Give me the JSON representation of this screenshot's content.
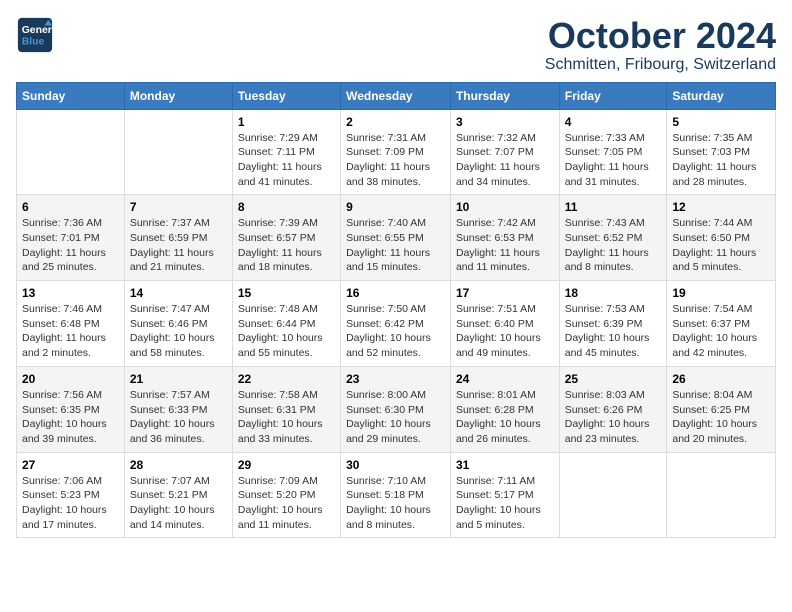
{
  "header": {
    "logo": {
      "general": "General",
      "blue": "Blue"
    },
    "month": "October 2024",
    "location": "Schmitten, Fribourg, Switzerland"
  },
  "columns": [
    "Sunday",
    "Monday",
    "Tuesday",
    "Wednesday",
    "Thursday",
    "Friday",
    "Saturday"
  ],
  "weeks": [
    [
      {
        "day": "",
        "sunrise": "",
        "sunset": "",
        "daylight": ""
      },
      {
        "day": "",
        "sunrise": "",
        "sunset": "",
        "daylight": ""
      },
      {
        "day": "1",
        "sunrise": "Sunrise: 7:29 AM",
        "sunset": "Sunset: 7:11 PM",
        "daylight": "Daylight: 11 hours and 41 minutes."
      },
      {
        "day": "2",
        "sunrise": "Sunrise: 7:31 AM",
        "sunset": "Sunset: 7:09 PM",
        "daylight": "Daylight: 11 hours and 38 minutes."
      },
      {
        "day": "3",
        "sunrise": "Sunrise: 7:32 AM",
        "sunset": "Sunset: 7:07 PM",
        "daylight": "Daylight: 11 hours and 34 minutes."
      },
      {
        "day": "4",
        "sunrise": "Sunrise: 7:33 AM",
        "sunset": "Sunset: 7:05 PM",
        "daylight": "Daylight: 11 hours and 31 minutes."
      },
      {
        "day": "5",
        "sunrise": "Sunrise: 7:35 AM",
        "sunset": "Sunset: 7:03 PM",
        "daylight": "Daylight: 11 hours and 28 minutes."
      }
    ],
    [
      {
        "day": "6",
        "sunrise": "Sunrise: 7:36 AM",
        "sunset": "Sunset: 7:01 PM",
        "daylight": "Daylight: 11 hours and 25 minutes."
      },
      {
        "day": "7",
        "sunrise": "Sunrise: 7:37 AM",
        "sunset": "Sunset: 6:59 PM",
        "daylight": "Daylight: 11 hours and 21 minutes."
      },
      {
        "day": "8",
        "sunrise": "Sunrise: 7:39 AM",
        "sunset": "Sunset: 6:57 PM",
        "daylight": "Daylight: 11 hours and 18 minutes."
      },
      {
        "day": "9",
        "sunrise": "Sunrise: 7:40 AM",
        "sunset": "Sunset: 6:55 PM",
        "daylight": "Daylight: 11 hours and 15 minutes."
      },
      {
        "day": "10",
        "sunrise": "Sunrise: 7:42 AM",
        "sunset": "Sunset: 6:53 PM",
        "daylight": "Daylight: 11 hours and 11 minutes."
      },
      {
        "day": "11",
        "sunrise": "Sunrise: 7:43 AM",
        "sunset": "Sunset: 6:52 PM",
        "daylight": "Daylight: 11 hours and 8 minutes."
      },
      {
        "day": "12",
        "sunrise": "Sunrise: 7:44 AM",
        "sunset": "Sunset: 6:50 PM",
        "daylight": "Daylight: 11 hours and 5 minutes."
      }
    ],
    [
      {
        "day": "13",
        "sunrise": "Sunrise: 7:46 AM",
        "sunset": "Sunset: 6:48 PM",
        "daylight": "Daylight: 11 hours and 2 minutes."
      },
      {
        "day": "14",
        "sunrise": "Sunrise: 7:47 AM",
        "sunset": "Sunset: 6:46 PM",
        "daylight": "Daylight: 10 hours and 58 minutes."
      },
      {
        "day": "15",
        "sunrise": "Sunrise: 7:48 AM",
        "sunset": "Sunset: 6:44 PM",
        "daylight": "Daylight: 10 hours and 55 minutes."
      },
      {
        "day": "16",
        "sunrise": "Sunrise: 7:50 AM",
        "sunset": "Sunset: 6:42 PM",
        "daylight": "Daylight: 10 hours and 52 minutes."
      },
      {
        "day": "17",
        "sunrise": "Sunrise: 7:51 AM",
        "sunset": "Sunset: 6:40 PM",
        "daylight": "Daylight: 10 hours and 49 minutes."
      },
      {
        "day": "18",
        "sunrise": "Sunrise: 7:53 AM",
        "sunset": "Sunset: 6:39 PM",
        "daylight": "Daylight: 10 hours and 45 minutes."
      },
      {
        "day": "19",
        "sunrise": "Sunrise: 7:54 AM",
        "sunset": "Sunset: 6:37 PM",
        "daylight": "Daylight: 10 hours and 42 minutes."
      }
    ],
    [
      {
        "day": "20",
        "sunrise": "Sunrise: 7:56 AM",
        "sunset": "Sunset: 6:35 PM",
        "daylight": "Daylight: 10 hours and 39 minutes."
      },
      {
        "day": "21",
        "sunrise": "Sunrise: 7:57 AM",
        "sunset": "Sunset: 6:33 PM",
        "daylight": "Daylight: 10 hours and 36 minutes."
      },
      {
        "day": "22",
        "sunrise": "Sunrise: 7:58 AM",
        "sunset": "Sunset: 6:31 PM",
        "daylight": "Daylight: 10 hours and 33 minutes."
      },
      {
        "day": "23",
        "sunrise": "Sunrise: 8:00 AM",
        "sunset": "Sunset: 6:30 PM",
        "daylight": "Daylight: 10 hours and 29 minutes."
      },
      {
        "day": "24",
        "sunrise": "Sunrise: 8:01 AM",
        "sunset": "Sunset: 6:28 PM",
        "daylight": "Daylight: 10 hours and 26 minutes."
      },
      {
        "day": "25",
        "sunrise": "Sunrise: 8:03 AM",
        "sunset": "Sunset: 6:26 PM",
        "daylight": "Daylight: 10 hours and 23 minutes."
      },
      {
        "day": "26",
        "sunrise": "Sunrise: 8:04 AM",
        "sunset": "Sunset: 6:25 PM",
        "daylight": "Daylight: 10 hours and 20 minutes."
      }
    ],
    [
      {
        "day": "27",
        "sunrise": "Sunrise: 7:06 AM",
        "sunset": "Sunset: 5:23 PM",
        "daylight": "Daylight: 10 hours and 17 minutes."
      },
      {
        "day": "28",
        "sunrise": "Sunrise: 7:07 AM",
        "sunset": "Sunset: 5:21 PM",
        "daylight": "Daylight: 10 hours and 14 minutes."
      },
      {
        "day": "29",
        "sunrise": "Sunrise: 7:09 AM",
        "sunset": "Sunset: 5:20 PM",
        "daylight": "Daylight: 10 hours and 11 minutes."
      },
      {
        "day": "30",
        "sunrise": "Sunrise: 7:10 AM",
        "sunset": "Sunset: 5:18 PM",
        "daylight": "Daylight: 10 hours and 8 minutes."
      },
      {
        "day": "31",
        "sunrise": "Sunrise: 7:11 AM",
        "sunset": "Sunset: 5:17 PM",
        "daylight": "Daylight: 10 hours and 5 minutes."
      },
      {
        "day": "",
        "sunrise": "",
        "sunset": "",
        "daylight": ""
      },
      {
        "day": "",
        "sunrise": "",
        "sunset": "",
        "daylight": ""
      }
    ]
  ]
}
